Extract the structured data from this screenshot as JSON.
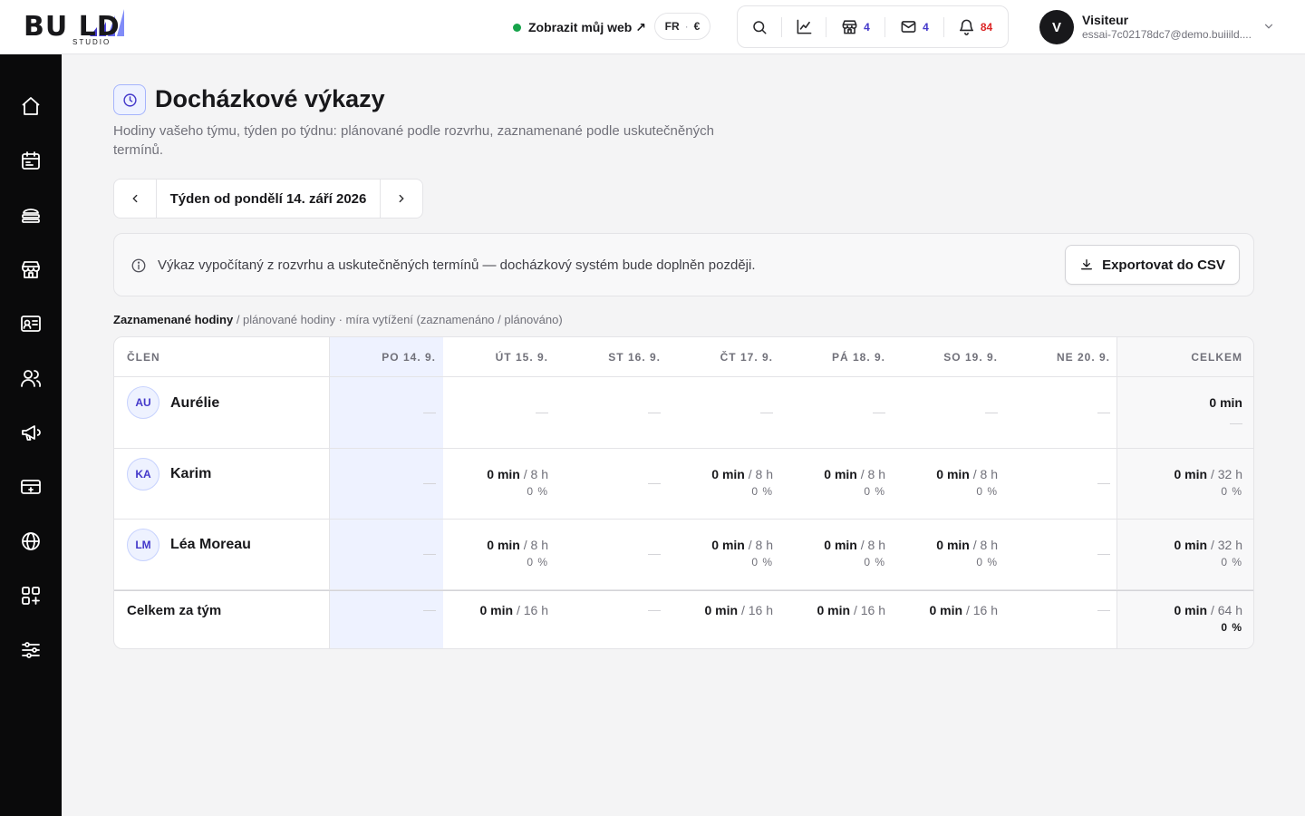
{
  "brand": {
    "name": "BU   LD",
    "sub": "STUDIO"
  },
  "header": {
    "view_site": "Zobrazit můj web ↗",
    "lang": "FR",
    "currency": "€",
    "shop_count": "4",
    "mail_count": "4",
    "notif_count": "84",
    "user": {
      "initial": "V",
      "name": "Visiteur",
      "email": "essai-7c02178dc7@demo.buiiild...."
    }
  },
  "page": {
    "title": "Docházkové výkazy",
    "subtitle": "Hodiny vašeho týmu, týden po týdnu: plánované podle rozvrhu, zaznamenané podle uskutečněných termínů.",
    "week_label": "Týden od pondělí 14. září 2026",
    "notice": "Výkaz vypočítaný z rozvrhu a uskutečněných termínů — docházkový systém bude doplněn později.",
    "export_label": "Exportovat do CSV",
    "legend_bold": "Zaznamenané hodiny",
    "legend_rest": " / plánované hodiny · míra vytížení (zaznamenáno / plánováno)"
  },
  "table": {
    "headers": [
      "ČLEN",
      "PO 14. 9.",
      "ÚT 15. 9.",
      "ST 16. 9.",
      "ČT 17. 9.",
      "PÁ 18. 9.",
      "SO 19. 9.",
      "NE 20. 9.",
      "CELKEM"
    ],
    "rows": [
      {
        "initials": "AU",
        "name": "Aurélie",
        "total": {
          "rec": "0 min"
        }
      },
      {
        "initials": "KA",
        "name": "Karim",
        "days": {
          "tue": {
            "rec": "0 min",
            "plan": " / 8 h",
            "pct": "0 %"
          },
          "thu": {
            "rec": "0 min",
            "plan": " / 8 h",
            "pct": "0 %"
          },
          "fri": {
            "rec": "0 min",
            "plan": " / 8 h",
            "pct": "0 %"
          },
          "sat": {
            "rec": "0 min",
            "plan": " / 8 h",
            "pct": "0 %"
          }
        },
        "total": {
          "rec": "0 min",
          "plan": " / 32 h",
          "pct": "0 %"
        }
      },
      {
        "initials": "LM",
        "name": "Léa Moreau",
        "days": {
          "tue": {
            "rec": "0 min",
            "plan": " / 8 h",
            "pct": "0 %"
          },
          "thu": {
            "rec": "0 min",
            "plan": " / 8 h",
            "pct": "0 %"
          },
          "fri": {
            "rec": "0 min",
            "plan": " / 8 h",
            "pct": "0 %"
          },
          "sat": {
            "rec": "0 min",
            "plan": " / 8 h",
            "pct": "0 %"
          }
        },
        "total": {
          "rec": "0 min",
          "plan": " / 32 h",
          "pct": "0 %"
        }
      }
    ],
    "footer": {
      "label": "Celkem za tým",
      "days": {
        "tue": {
          "rec": "0 min",
          "plan": " / 16 h"
        },
        "thu": {
          "rec": "0 min",
          "plan": " / 16 h"
        },
        "fri": {
          "rec": "0 min",
          "plan": " / 16 h"
        },
        "sat": {
          "rec": "0 min",
          "plan": " / 16 h"
        }
      },
      "total": {
        "rec": "0 min",
        "plan": " / 64 h",
        "pct": "0 %"
      }
    }
  },
  "colors": {
    "accent": "#4338ca",
    "danger": "#dc2626",
    "online": "#16a34a",
    "sidebar": "#0a0a0b",
    "today": "#eef2ff"
  },
  "sidebar_icons": [
    "home-icon",
    "calendar-icon",
    "services-icon",
    "shop-icon",
    "contact-card-icon",
    "team-icon",
    "megaphone-icon",
    "payment-card-icon",
    "globe-icon",
    "apps-icon",
    "settings-sliders-icon"
  ]
}
